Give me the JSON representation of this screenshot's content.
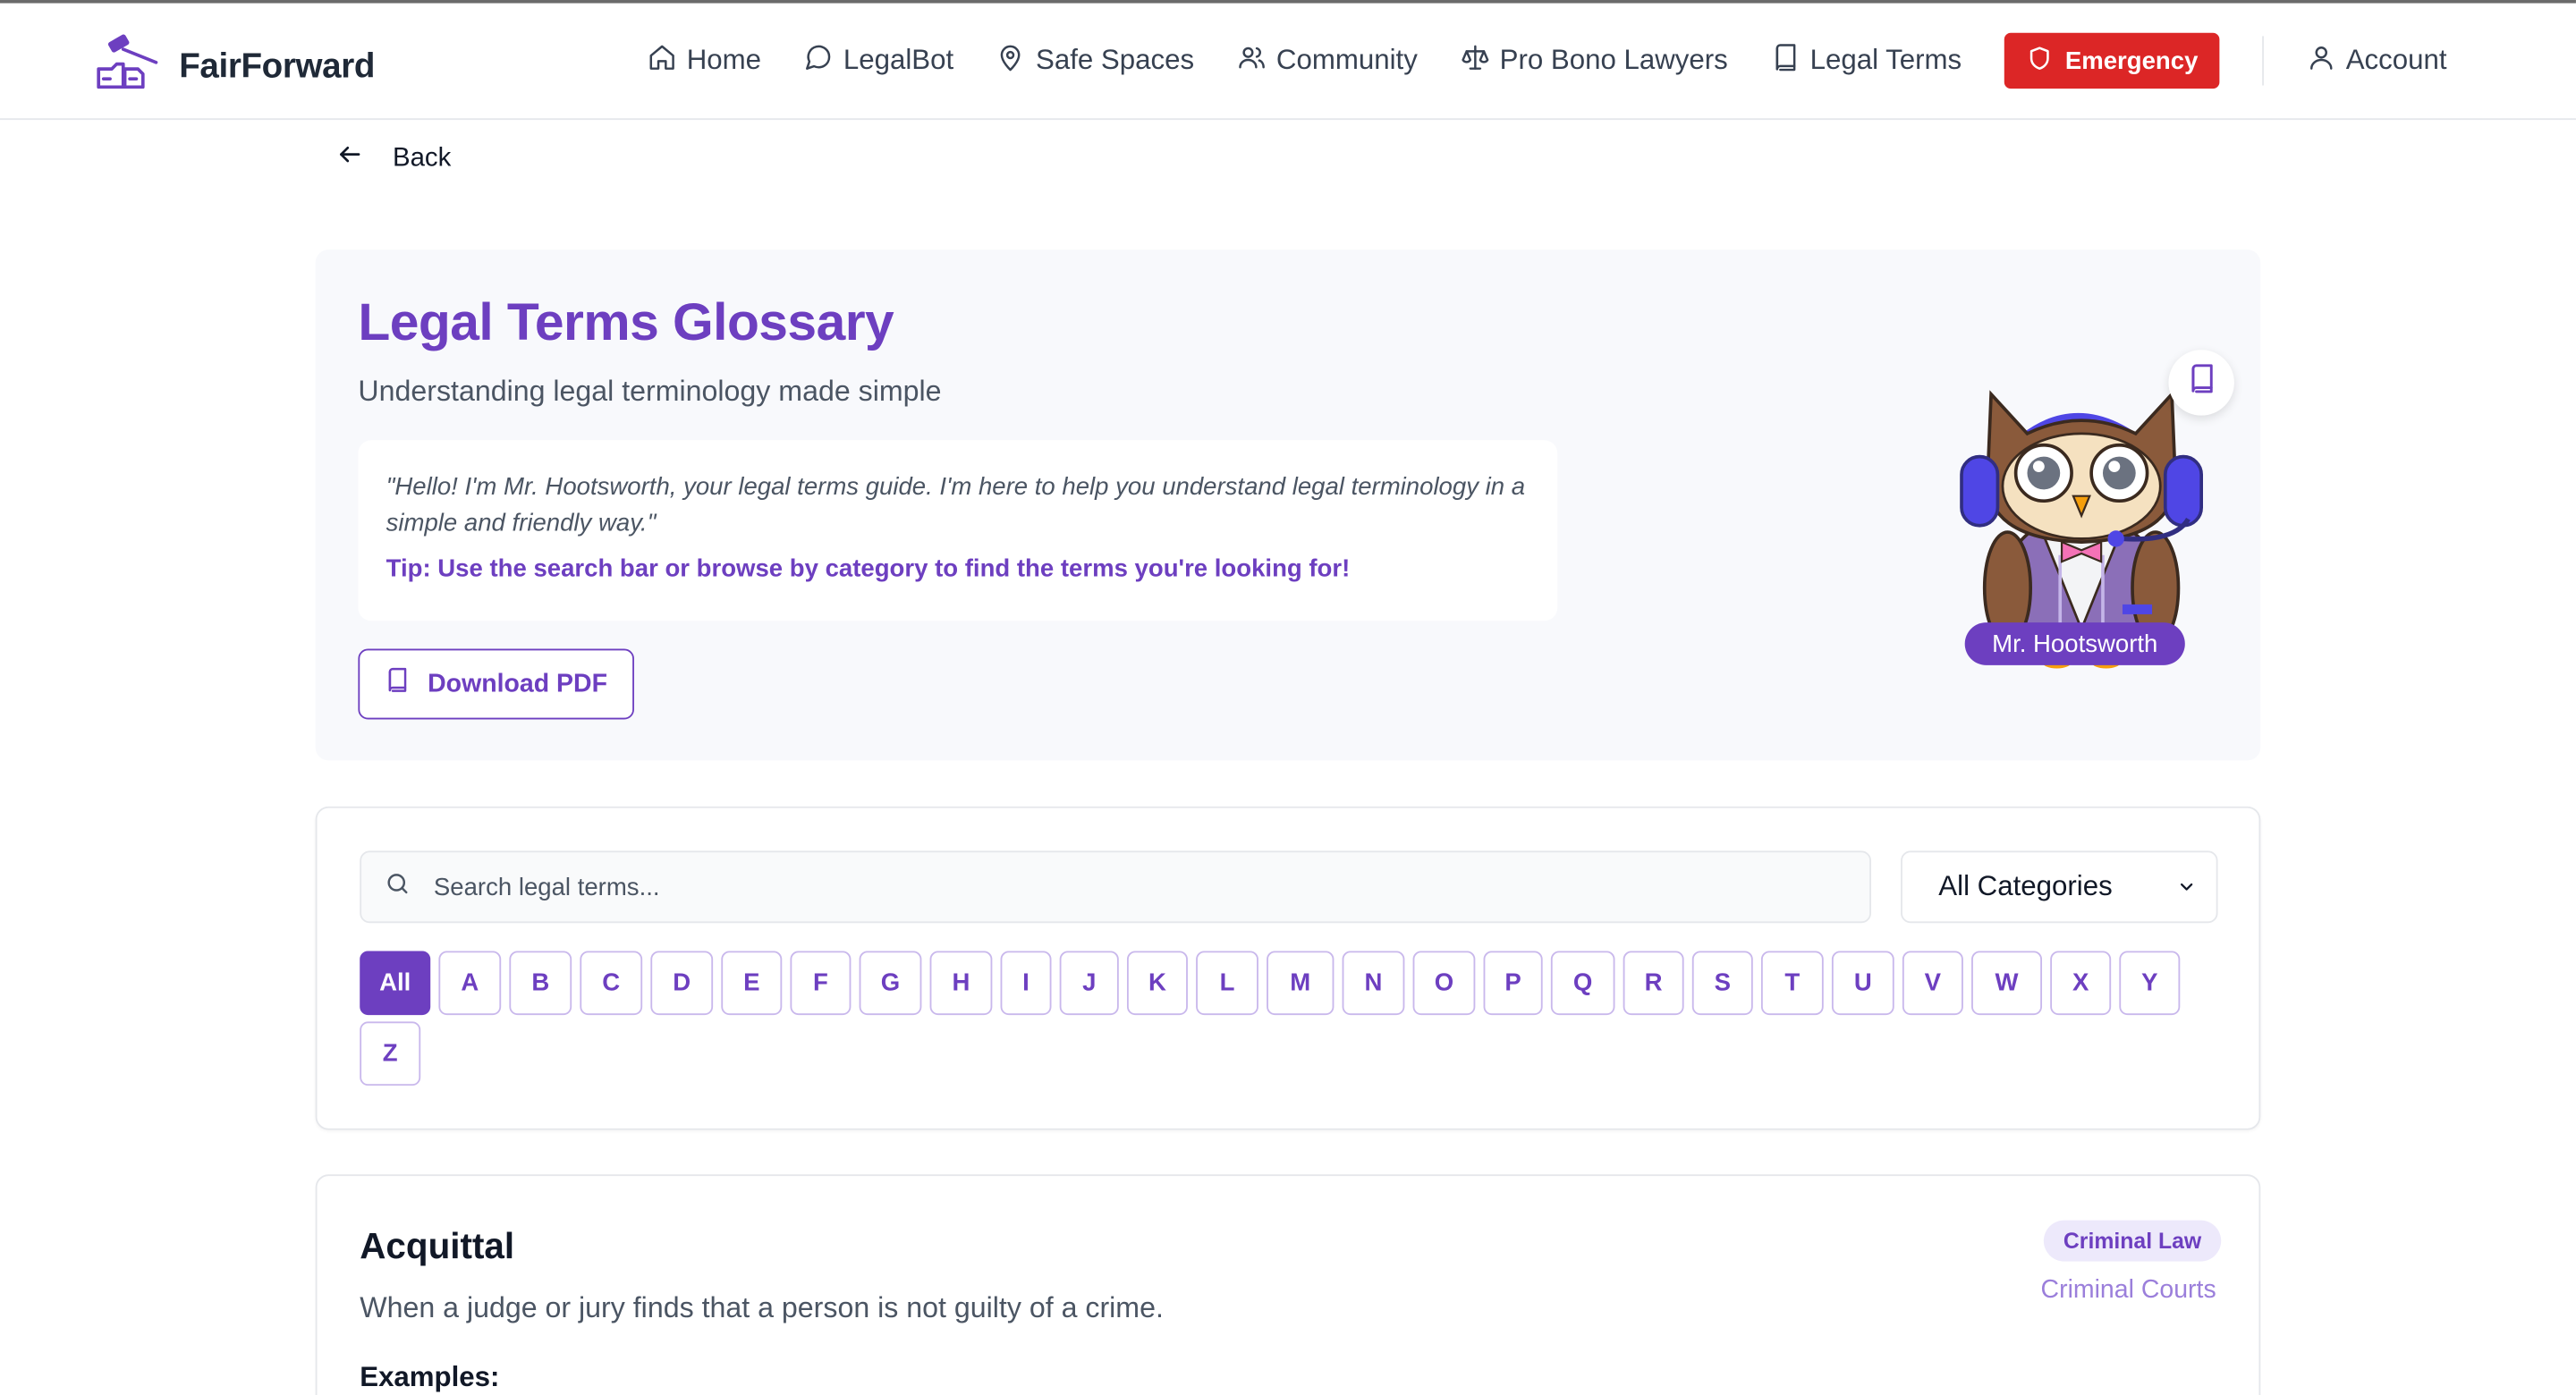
{
  "brand": {
    "name": "FairForward",
    "logo_icon": "gavel-hands-icon"
  },
  "nav": {
    "items": [
      {
        "label": "Home",
        "icon": "home-icon"
      },
      {
        "label": "LegalBot",
        "icon": "chat-bubble-icon"
      },
      {
        "label": "Safe Spaces",
        "icon": "map-pin-icon"
      },
      {
        "label": "Community",
        "icon": "users-icon"
      },
      {
        "label": "Pro Bono Lawyers",
        "icon": "scale-icon"
      },
      {
        "label": "Legal Terms",
        "icon": "book-icon"
      }
    ],
    "emergency_label": "Emergency",
    "account_label": "Account"
  },
  "back_label": "Back",
  "hero": {
    "title": "Legal Terms Glossary",
    "subtitle": "Understanding legal terminology made simple",
    "quote": "\"Hello! I'm Mr. Hootsworth, your legal terms guide. I'm here to help you understand legal terminology in a simple and friendly way.\"",
    "tip": "Tip: Use the search bar or browse by category to find the terms you're looking for!",
    "download_label": "Download PDF",
    "mascot_name": "Mr. Hootsworth"
  },
  "search": {
    "placeholder": "Search legal terms...",
    "value": "",
    "category_selected": "All Categories"
  },
  "letters": [
    "All",
    "A",
    "B",
    "C",
    "D",
    "E",
    "F",
    "G",
    "H",
    "I",
    "J",
    "K",
    "L",
    "M",
    "N",
    "O",
    "P",
    "Q",
    "R",
    "S",
    "T",
    "U",
    "V",
    "W",
    "X",
    "Y",
    "Z"
  ],
  "active_letter": "All",
  "term": {
    "title": "Acquittal",
    "definition": "When a judge or jury finds that a person is not guilty of a crime.",
    "examples_label": "Examples:",
    "category": "Criminal Law",
    "court": "Criminal Courts"
  },
  "colors": {
    "accent": "#6d3fc0",
    "emergency": "#dc2626",
    "text_muted": "#4b5563"
  }
}
